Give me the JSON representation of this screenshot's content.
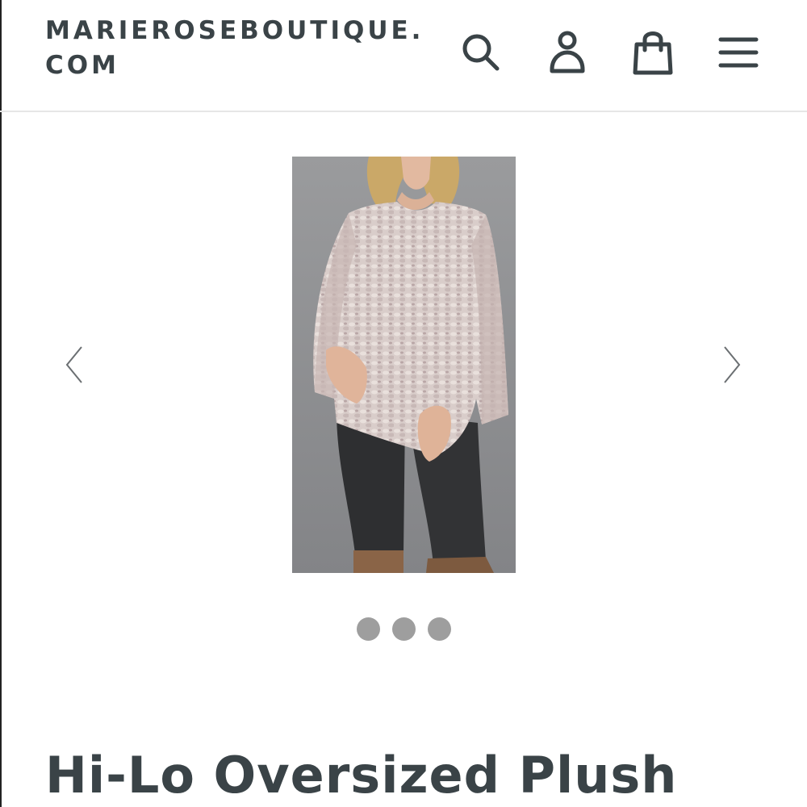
{
  "header": {
    "logo_line1": "MARIEROSEBOUTIQUE.",
    "logo_line2": "COM",
    "icons": {
      "search": "search-icon",
      "account": "account-icon",
      "cart": "shopping-bag-icon",
      "menu": "hamburger-menu-icon"
    },
    "icon_color": "#3a4347"
  },
  "gallery": {
    "image_alt": "Hi-Lo Oversized Plush",
    "prev_icon": "chevron-left-icon",
    "next_icon": "chevron-right-icon",
    "slide_count": 3,
    "dot_color": "#9e9e9e"
  },
  "product": {
    "title": "Hi-Lo Oversized Plush"
  }
}
